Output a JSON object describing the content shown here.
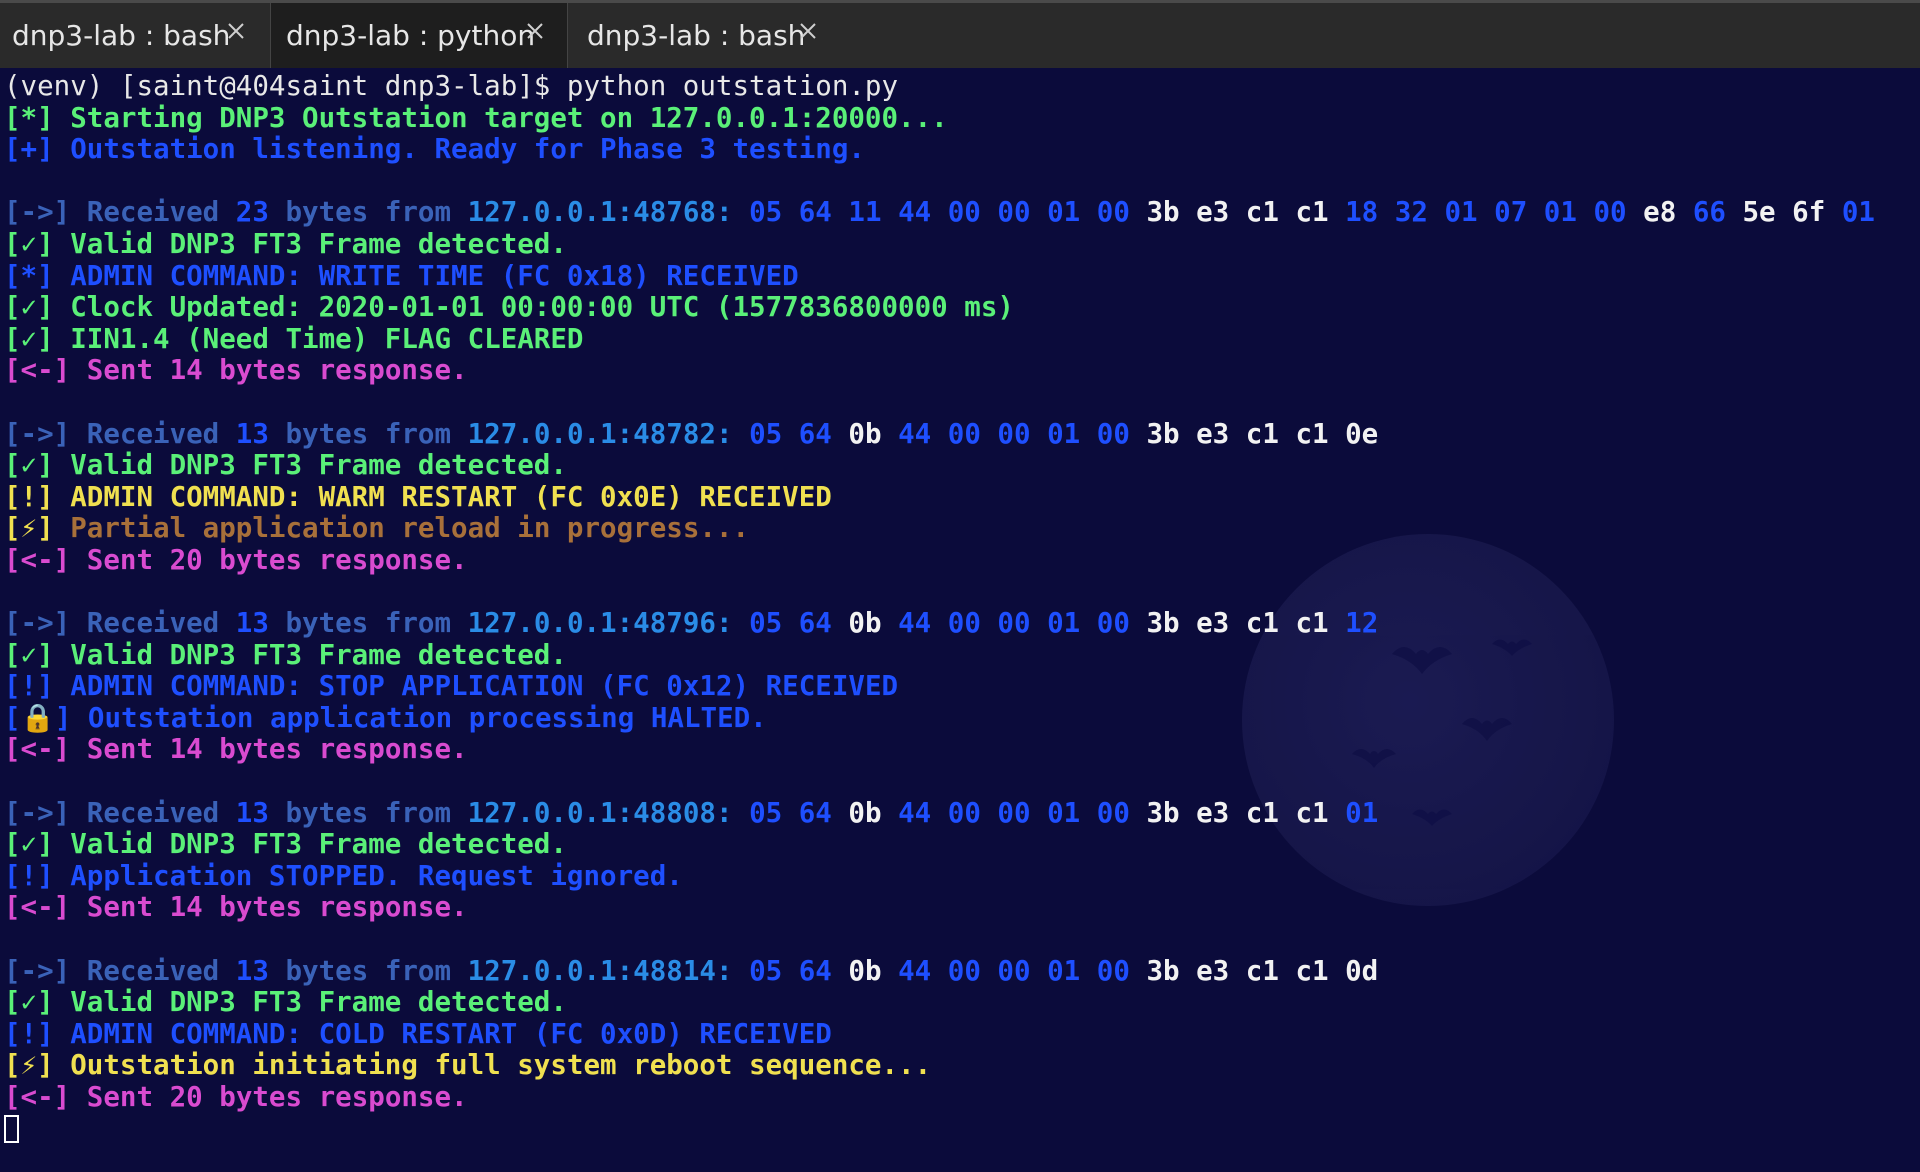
{
  "tabs": [
    {
      "title": "dnp3-lab : bash",
      "active": false
    },
    {
      "title": "dnp3-lab : python",
      "active": true
    },
    {
      "title": "dnp3-lab : bash",
      "active": false
    }
  ],
  "colors": {
    "white": "#e8e8e8",
    "green": "#5af078",
    "blue": "#1e4fff",
    "steel": "#3a62b8",
    "cyan": "#2a8ce6",
    "yellow": "#f0e050",
    "magenta": "#d94bd0",
    "orange": "#a8703a",
    "bright": "#f2f2f2"
  },
  "terminal_lines": [
    {
      "bold": false,
      "segs": [
        {
          "t": "(venv) [saint@404saint dnp3-lab]$ python outstation.py",
          "c": "white"
        }
      ]
    },
    {
      "bold": true,
      "segs": [
        {
          "t": "[*] Starting DNP3 Outstation target on 127.0.0.1:20000...",
          "c": "green"
        }
      ]
    },
    {
      "bold": true,
      "segs": [
        {
          "t": "[+] Outstation listening. Ready for Phase 3 testing.",
          "c": "blue"
        }
      ]
    },
    {
      "bold": false,
      "segs": []
    },
    {
      "bold": true,
      "segs": [
        {
          "t": "[->] Received ",
          "c": "steel"
        },
        {
          "t": "23",
          "c": "blue"
        },
        {
          "t": " bytes from ",
          "c": "steel"
        },
        {
          "t": "127.0.0.1:48768:",
          "c": "cyan"
        },
        {
          "t": " 05 64 11 44 00 00 01 00 ",
          "c": "blue"
        },
        {
          "t": "3b e3 c1 c1 ",
          "c": "bright"
        },
        {
          "t": "18 32 01 07 01 00 ",
          "c": "blue"
        },
        {
          "t": "e8 ",
          "c": "bright"
        },
        {
          "t": "66 ",
          "c": "blue"
        },
        {
          "t": "5e 6f ",
          "c": "bright"
        },
        {
          "t": "01",
          "c": "blue"
        }
      ]
    },
    {
      "bold": true,
      "segs": [
        {
          "t": "[✓] Valid DNP3 FT3 Frame detected.",
          "c": "green"
        }
      ]
    },
    {
      "bold": true,
      "segs": [
        {
          "t": "[*] ADMIN COMMAND: WRITE TIME (FC 0x18) RECEIVED",
          "c": "blue"
        }
      ]
    },
    {
      "bold": true,
      "segs": [
        {
          "t": "[✓] Clock Updated: 2020-01-01 00:00:00 UTC (1577836800000 ms)",
          "c": "green"
        }
      ]
    },
    {
      "bold": true,
      "segs": [
        {
          "t": "[✓] IIN1.4 (Need Time) FLAG CLEARED",
          "c": "green"
        }
      ]
    },
    {
      "bold": true,
      "segs": [
        {
          "t": "[<-] Sent ",
          "c": "magenta"
        },
        {
          "t": "14",
          "c": "magenta"
        },
        {
          "t": " bytes response.",
          "c": "magenta"
        }
      ]
    },
    {
      "bold": false,
      "segs": []
    },
    {
      "bold": true,
      "segs": [
        {
          "t": "[->] Received ",
          "c": "steel"
        },
        {
          "t": "13",
          "c": "blue"
        },
        {
          "t": " bytes from ",
          "c": "steel"
        },
        {
          "t": "127.0.0.1:48782:",
          "c": "cyan"
        },
        {
          "t": " 05 64 ",
          "c": "blue"
        },
        {
          "t": "0b ",
          "c": "bright"
        },
        {
          "t": "44 00 00 01 00 ",
          "c": "blue"
        },
        {
          "t": "3b e3 c1 c1 0e",
          "c": "bright"
        }
      ]
    },
    {
      "bold": true,
      "segs": [
        {
          "t": "[✓] Valid DNP3 FT3 Frame detected.",
          "c": "green"
        }
      ]
    },
    {
      "bold": true,
      "segs": [
        {
          "t": "[!] ADMIN COMMAND: WARM RESTART (FC 0x0E) RECEIVED",
          "c": "yellow"
        }
      ]
    },
    {
      "bold": true,
      "segs": [
        {
          "t": "[⚡] ",
          "c": "yellow"
        },
        {
          "t": "Partial application reload in progress...",
          "c": "orange"
        }
      ]
    },
    {
      "bold": true,
      "segs": [
        {
          "t": "[<-] Sent ",
          "c": "magenta"
        },
        {
          "t": "20",
          "c": "magenta"
        },
        {
          "t": " bytes response.",
          "c": "magenta"
        }
      ]
    },
    {
      "bold": false,
      "segs": []
    },
    {
      "bold": true,
      "segs": [
        {
          "t": "[->] Received ",
          "c": "steel"
        },
        {
          "t": "13",
          "c": "blue"
        },
        {
          "t": " bytes from ",
          "c": "steel"
        },
        {
          "t": "127.0.0.1:48796:",
          "c": "cyan"
        },
        {
          "t": " 05 64 ",
          "c": "blue"
        },
        {
          "t": "0b ",
          "c": "bright"
        },
        {
          "t": "44 00 00 01 00 ",
          "c": "blue"
        },
        {
          "t": "3b e3 c1 c1 ",
          "c": "bright"
        },
        {
          "t": "12",
          "c": "blue"
        }
      ]
    },
    {
      "bold": true,
      "segs": [
        {
          "t": "[✓] Valid DNP3 FT3 Frame detected.",
          "c": "green"
        }
      ]
    },
    {
      "bold": true,
      "segs": [
        {
          "t": "[!] ",
          "c": "blue"
        },
        {
          "t": "ADMIN COMMAND: STOP APPLICATION (FC 0x12) RECEIVED",
          "c": "blue"
        }
      ]
    },
    {
      "bold": true,
      "segs": [
        {
          "t": "[",
          "c": "blue"
        },
        {
          "t": "🔒",
          "c": "yellow"
        },
        {
          "t": "] Outstation application processing HALTED.",
          "c": "blue"
        }
      ]
    },
    {
      "bold": true,
      "segs": [
        {
          "t": "[<-] Sent ",
          "c": "magenta"
        },
        {
          "t": "14",
          "c": "magenta"
        },
        {
          "t": " bytes response.",
          "c": "magenta"
        }
      ]
    },
    {
      "bold": false,
      "segs": []
    },
    {
      "bold": true,
      "segs": [
        {
          "t": "[->] Received ",
          "c": "steel"
        },
        {
          "t": "13",
          "c": "blue"
        },
        {
          "t": " bytes from ",
          "c": "steel"
        },
        {
          "t": "127.0.0.1:48808:",
          "c": "cyan"
        },
        {
          "t": " 05 64 ",
          "c": "blue"
        },
        {
          "t": "0b ",
          "c": "bright"
        },
        {
          "t": "44 00 00 01 00 ",
          "c": "blue"
        },
        {
          "t": "3b e3 c1 c1 ",
          "c": "bright"
        },
        {
          "t": "01",
          "c": "blue"
        }
      ]
    },
    {
      "bold": true,
      "segs": [
        {
          "t": "[✓] Valid DNP3 FT3 Frame detected.",
          "c": "green"
        }
      ]
    },
    {
      "bold": true,
      "segs": [
        {
          "t": "[!] Application STOPPED. Request ignored.",
          "c": "blue"
        }
      ]
    },
    {
      "bold": true,
      "segs": [
        {
          "t": "[<-] Sent ",
          "c": "magenta"
        },
        {
          "t": "14",
          "c": "magenta"
        },
        {
          "t": " bytes response.",
          "c": "magenta"
        }
      ]
    },
    {
      "bold": false,
      "segs": []
    },
    {
      "bold": true,
      "segs": [
        {
          "t": "[->] Received ",
          "c": "steel"
        },
        {
          "t": "13",
          "c": "blue"
        },
        {
          "t": " bytes from ",
          "c": "steel"
        },
        {
          "t": "127.0.0.1:48814:",
          "c": "cyan"
        },
        {
          "t": " 05 64 ",
          "c": "blue"
        },
        {
          "t": "0b ",
          "c": "bright"
        },
        {
          "t": "44 00 00 01 00 ",
          "c": "blue"
        },
        {
          "t": "3b e3 c1 c1 0d",
          "c": "bright"
        }
      ]
    },
    {
      "bold": true,
      "segs": [
        {
          "t": "[✓] Valid DNP3 FT3 Frame detected.",
          "c": "green"
        }
      ]
    },
    {
      "bold": true,
      "segs": [
        {
          "t": "[!] ADMIN COMMAND: COLD RESTART (FC 0x0D) RECEIVED",
          "c": "blue"
        }
      ]
    },
    {
      "bold": true,
      "segs": [
        {
          "t": "[⚡] Outstation initiating full system reboot sequence...",
          "c": "yellow"
        }
      ]
    },
    {
      "bold": true,
      "segs": [
        {
          "t": "[<-] Sent ",
          "c": "magenta"
        },
        {
          "t": "20",
          "c": "magenta"
        },
        {
          "t": " bytes response.",
          "c": "magenta"
        }
      ]
    }
  ]
}
